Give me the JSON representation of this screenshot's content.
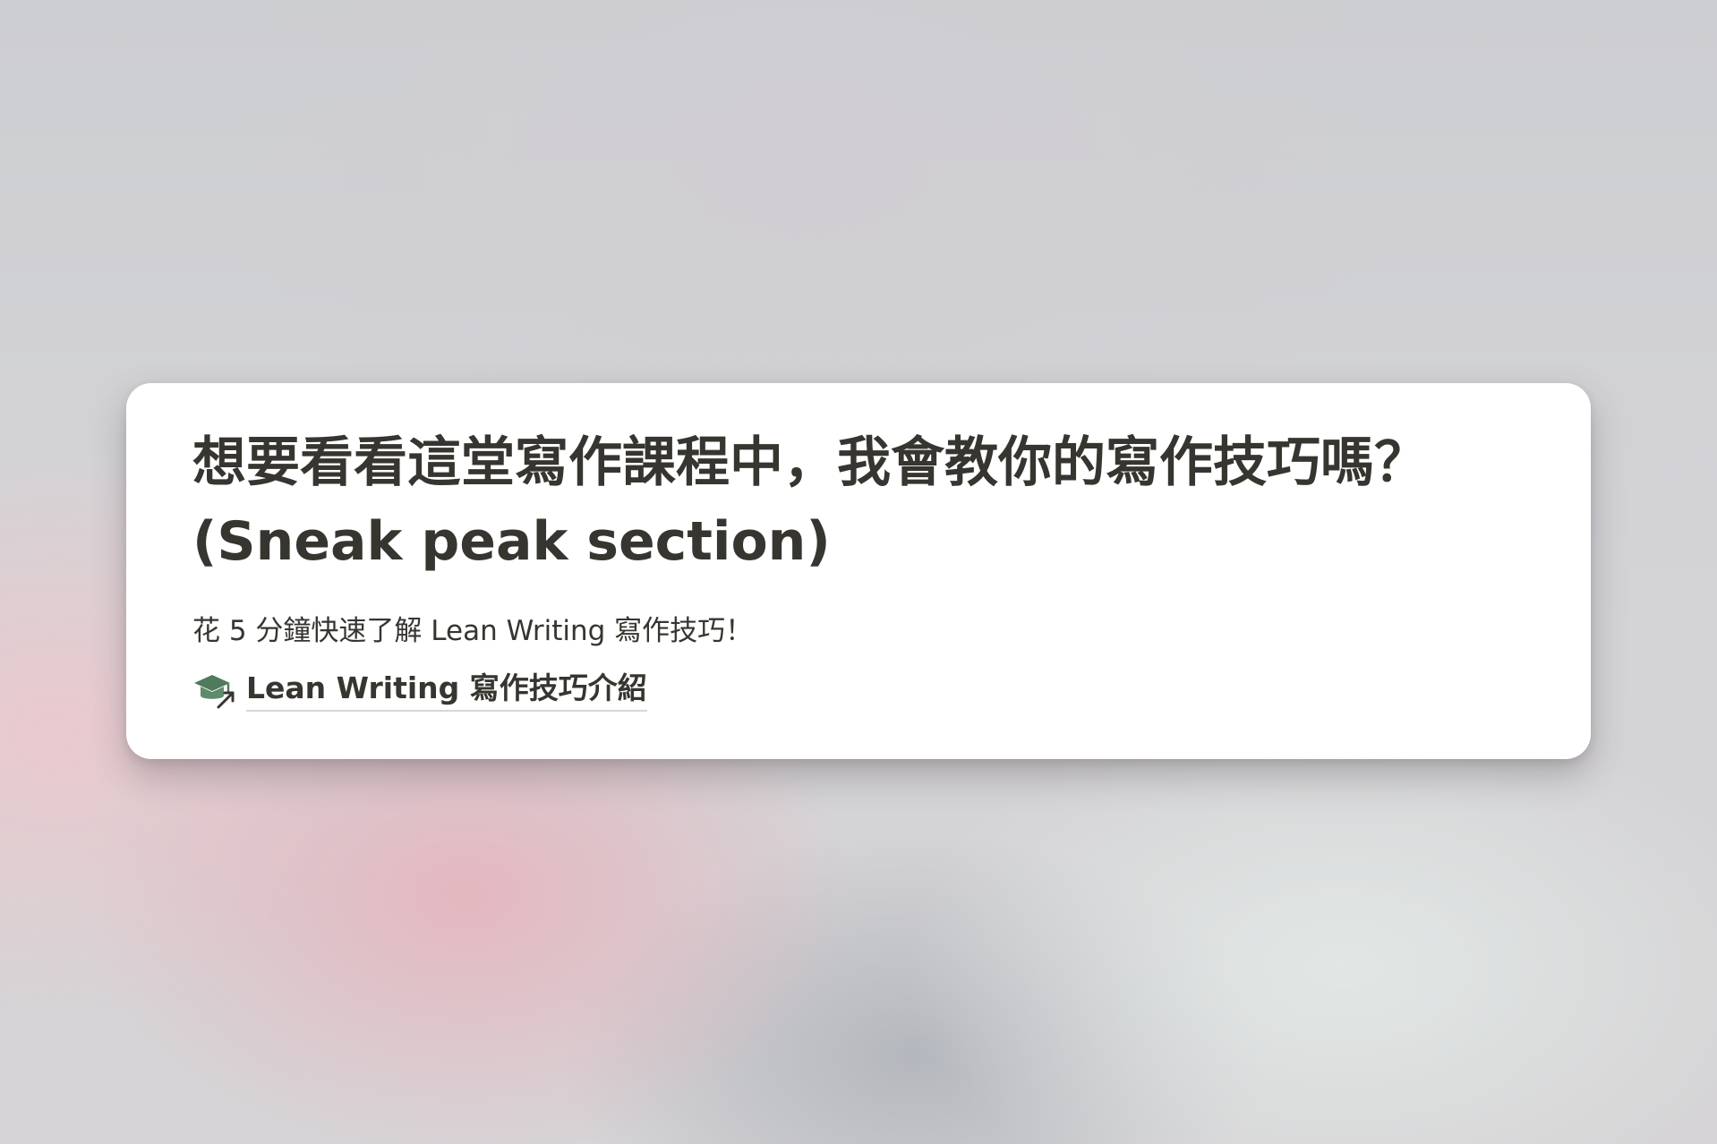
{
  "card": {
    "title": "想要看看這堂寫作課程中，我會教你的寫作技巧嗎？ (Sneak peak section)",
    "subtitle": "花 5 分鐘快速了解 Lean Writing 寫作技巧！",
    "link": {
      "icon": "graduation-cap-icon",
      "label": "Lean Writing 寫作技巧介紹",
      "icon_color": "#4f7a5c"
    }
  }
}
